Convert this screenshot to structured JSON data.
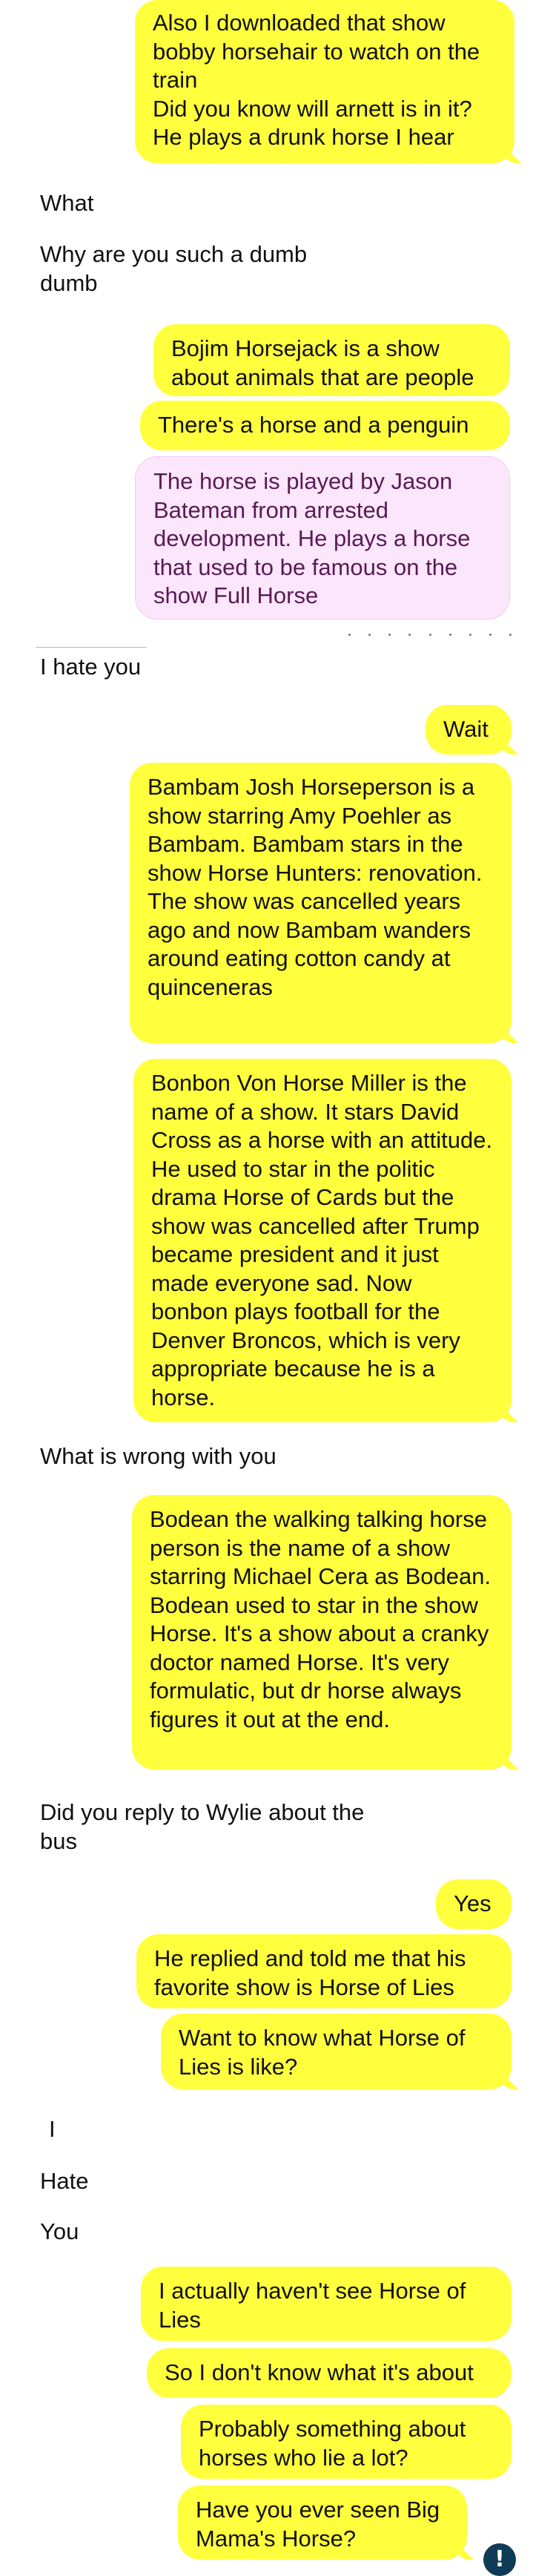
{
  "colors": {
    "sent_bubble": "#ffff3d",
    "pending_bubble": "#fce6fb",
    "pending_text": "#5a1a56",
    "error_icon": "#0f3b57"
  },
  "messages": [
    {
      "side": "sent",
      "text": "Also I downloaded that show bobby horsehair to watch on the train\nDid you know will arnett is in it? He plays a drunk horse I hear"
    },
    {
      "side": "received",
      "text": "What"
    },
    {
      "side": "received",
      "text": "Why are you such a dumb dumb"
    },
    {
      "side": "sent",
      "text": "Bojim Horsejack is a show about animals that are people"
    },
    {
      "side": "sent",
      "text": "There's a horse and a penguin"
    },
    {
      "side": "sent",
      "status": "pending",
      "text": "The horse is played by Jason Bateman from arrested development. He plays a horse that used to be famous on the show Full Horse"
    },
    {
      "side": "received",
      "text": "I hate you"
    },
    {
      "side": "sent",
      "text": "Wait"
    },
    {
      "side": "sent",
      "text": "Bambam Josh Horseperson is a show starring Amy Poehler as Bambam. Bambam stars in the show Horse Hunters: renovation. The show was cancelled years ago and now Bambam wanders around eating cotton candy at quinceneras"
    },
    {
      "side": "sent",
      "text": "Bonbon Von Horse Miller is the name of a show. It stars David Cross as a horse with an attitude. He used to star in the politic drama Horse of Cards but the show was cancelled after Trump became president and it just made everyone sad. Now bonbon plays football for the Denver Broncos, which is very appropriate because he is a horse."
    },
    {
      "side": "received",
      "text": "What is wrong with you"
    },
    {
      "side": "sent",
      "text": "Bodean the walking talking horse person is the name of a show starring Michael Cera as Bodean. Bodean used to star in the show Horse. It's a show about a cranky doctor named Horse. It's very formulatic, but dr horse always figures it out at the end."
    },
    {
      "side": "received",
      "text": "Did you reply to Wylie about the bus"
    },
    {
      "side": "sent",
      "text": "Yes"
    },
    {
      "side": "sent",
      "text": "He replied and told me that his favorite show is Horse of Lies"
    },
    {
      "side": "sent",
      "text": "Want to know what Horse of Lies is like?"
    },
    {
      "side": "received",
      "text": "I"
    },
    {
      "side": "received",
      "text": "Hate"
    },
    {
      "side": "received",
      "text": "You"
    },
    {
      "side": "sent",
      "text": "I actually haven't see Horse of Lies"
    },
    {
      "side": "sent",
      "text": "So I don't know what it's about"
    },
    {
      "side": "sent",
      "text": "Probably something about horses who lie a lot?"
    },
    {
      "side": "sent",
      "status": "failed",
      "text": "Have you ever seen Big Mama's Horse?"
    }
  ],
  "error_glyph": "!"
}
